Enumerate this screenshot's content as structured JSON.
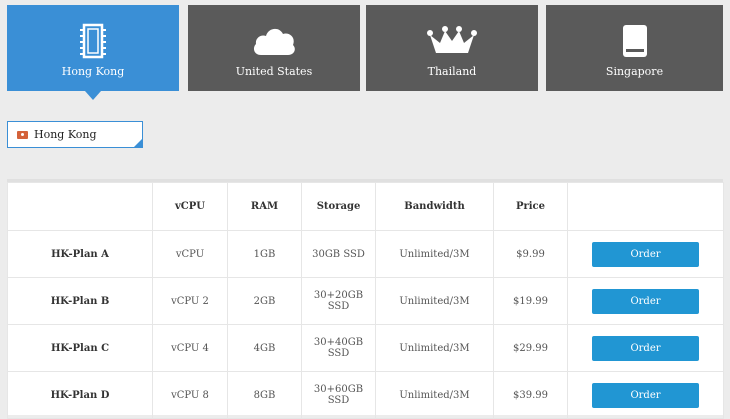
{
  "tabs": [
    {
      "label": "Hong Kong",
      "icon": "chip-icon",
      "active": true
    },
    {
      "label": "United States",
      "icon": "cloud-icon",
      "active": false
    },
    {
      "label": "Thailand",
      "icon": "crown-icon",
      "active": false
    },
    {
      "label": "Singapore",
      "icon": "drive-icon",
      "active": false
    }
  ],
  "location_select": {
    "value": "Hong Kong"
  },
  "table": {
    "headers": [
      "",
      "vCPU",
      "RAM",
      "Storage",
      "Bandwidth",
      "Price",
      ""
    ],
    "rows": [
      {
        "plan": "HK-Plan A",
        "vcpu": "vCPU",
        "ram": "1GB",
        "storage": "30GB SSD",
        "bandwidth": "Unlimited/3M",
        "price": "$9.99",
        "action": "Order"
      },
      {
        "plan": "HK-Plan B",
        "vcpu": "vCPU 2",
        "ram": "2GB",
        "storage": "30+20GB SSD",
        "bandwidth": "Unlimited/3M",
        "price": "$19.99",
        "action": "Order"
      },
      {
        "plan": "HK-Plan C",
        "vcpu": "vCPU 4",
        "ram": "4GB",
        "storage": "30+40GB SSD",
        "bandwidth": "Unlimited/3M",
        "price": "$29.99",
        "action": "Order"
      },
      {
        "plan": "HK-Plan D",
        "vcpu": "vCPU 8",
        "ram": "8GB",
        "storage": "30+60GB SSD",
        "bandwidth": "Unlimited/3M",
        "price": "$39.99",
        "action": "Order"
      }
    ]
  }
}
